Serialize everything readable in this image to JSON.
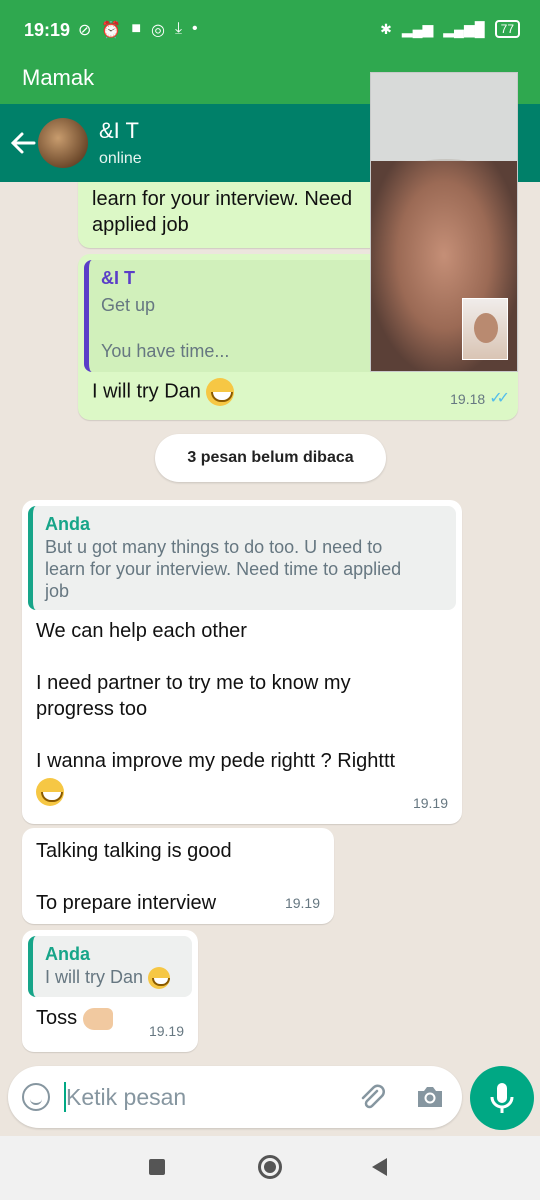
{
  "status_bar": {
    "time": "19:19",
    "battery": "77"
  },
  "call_bar": {
    "name": "Mamak"
  },
  "header": {
    "title": "&I T",
    "status": "online"
  },
  "messages": {
    "first_partial": {
      "line1": "learn for your interview. Need",
      "line2": "applied job"
    },
    "second": {
      "quote_name": "&I T",
      "quote_line1": "Get up",
      "quote_line2": "You have time...",
      "text": "I will try Dan",
      "time": "19.18"
    },
    "unread_banner": "3 pesan belum dibaca",
    "third": {
      "quote_name": "Anda",
      "quote_line1": "But u got many things to do too. U need to",
      "quote_line2": "learn for your interview. Need time to applied",
      "quote_line3": "job",
      "p1": "We can help each other",
      "p2a": "I need partner to try me to know my",
      "p2b": "progress too",
      "p3": "I wanna improve my pede rightt ? Righttt",
      "time": "19.19"
    },
    "fourth": {
      "l1": "Talking talking is good",
      "l2": "To prepare interview",
      "time": "19.19"
    },
    "fifth": {
      "quote_name": "Anda",
      "quote_text": "I will try Dan",
      "text": "Toss",
      "time": "19.19"
    }
  },
  "input": {
    "placeholder": "Ketik pesan"
  },
  "colors": {
    "header": "#008069",
    "status_bar": "#2fa84f",
    "outgoing": "#dcf8c6",
    "incoming": "#ffffff",
    "accent": "#00a884"
  }
}
